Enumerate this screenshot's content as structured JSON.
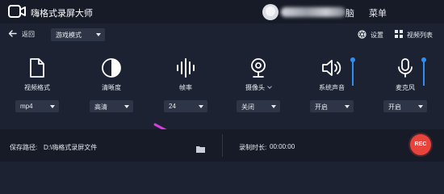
{
  "titlebar": {
    "title": "嗨格式录屏大师",
    "logo_icon": "camera-logo-icon",
    "user_suffix": "脑",
    "menu_label": "菜单"
  },
  "toolbar": {
    "back_label": "返回",
    "mode_value": "游戏模式",
    "settings_label": "设置",
    "video_list_label": "视频列表"
  },
  "options": [
    {
      "label": "视频格式",
      "icon": "file-icon",
      "value": "mp4"
    },
    {
      "label": "清晰度",
      "icon": "clarity-icon",
      "value": "高清"
    },
    {
      "label": "帧率",
      "icon": "waveform-icon",
      "value": "24"
    },
    {
      "label": "摄像头",
      "icon": "webcam-icon",
      "value": "关闭"
    },
    {
      "label": "系统声音",
      "icon": "speaker-icon",
      "value": "开启",
      "level": 1.0
    },
    {
      "label": "麦克风",
      "icon": "microphone-icon",
      "value": "开启",
      "level": 1.0
    }
  ],
  "bottombar": {
    "save_path_label": "保存路径:",
    "save_path_value": "D:\\嗨格式录屏文件",
    "duration_label": "录制时长:",
    "duration_value": "00:00:00",
    "rec_label": "REC"
  },
  "colors": {
    "background": "#1c2231",
    "bar_background": "#161b27",
    "accent_blue": "#2f8ff0",
    "rec_red": "#e8443b",
    "annotation_arrow": "#d63ce0"
  }
}
